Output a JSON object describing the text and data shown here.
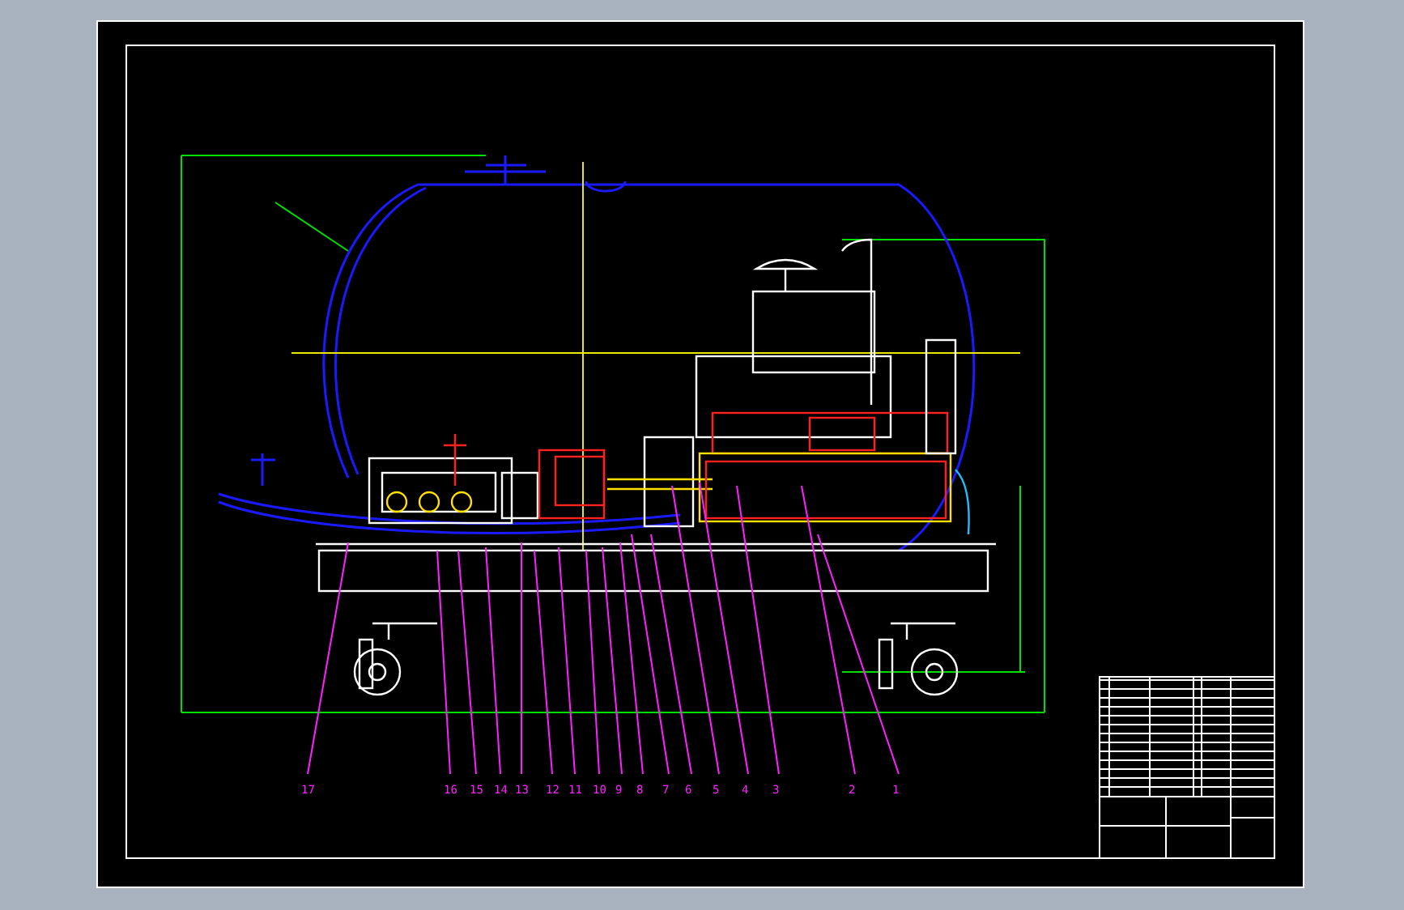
{
  "drawing": {
    "balloons": [
      {
        "label": "17"
      },
      {
        "label": "16"
      },
      {
        "label": "15"
      },
      {
        "label": "14"
      },
      {
        "label": "13"
      },
      {
        "label": "12"
      },
      {
        "label": "11"
      },
      {
        "label": "10"
      },
      {
        "label": "9"
      },
      {
        "label": "8"
      },
      {
        "label": "7"
      },
      {
        "label": "6"
      },
      {
        "label": "5"
      },
      {
        "label": "4"
      },
      {
        "label": "3"
      },
      {
        "label": "2"
      },
      {
        "label": "1"
      }
    ]
  }
}
